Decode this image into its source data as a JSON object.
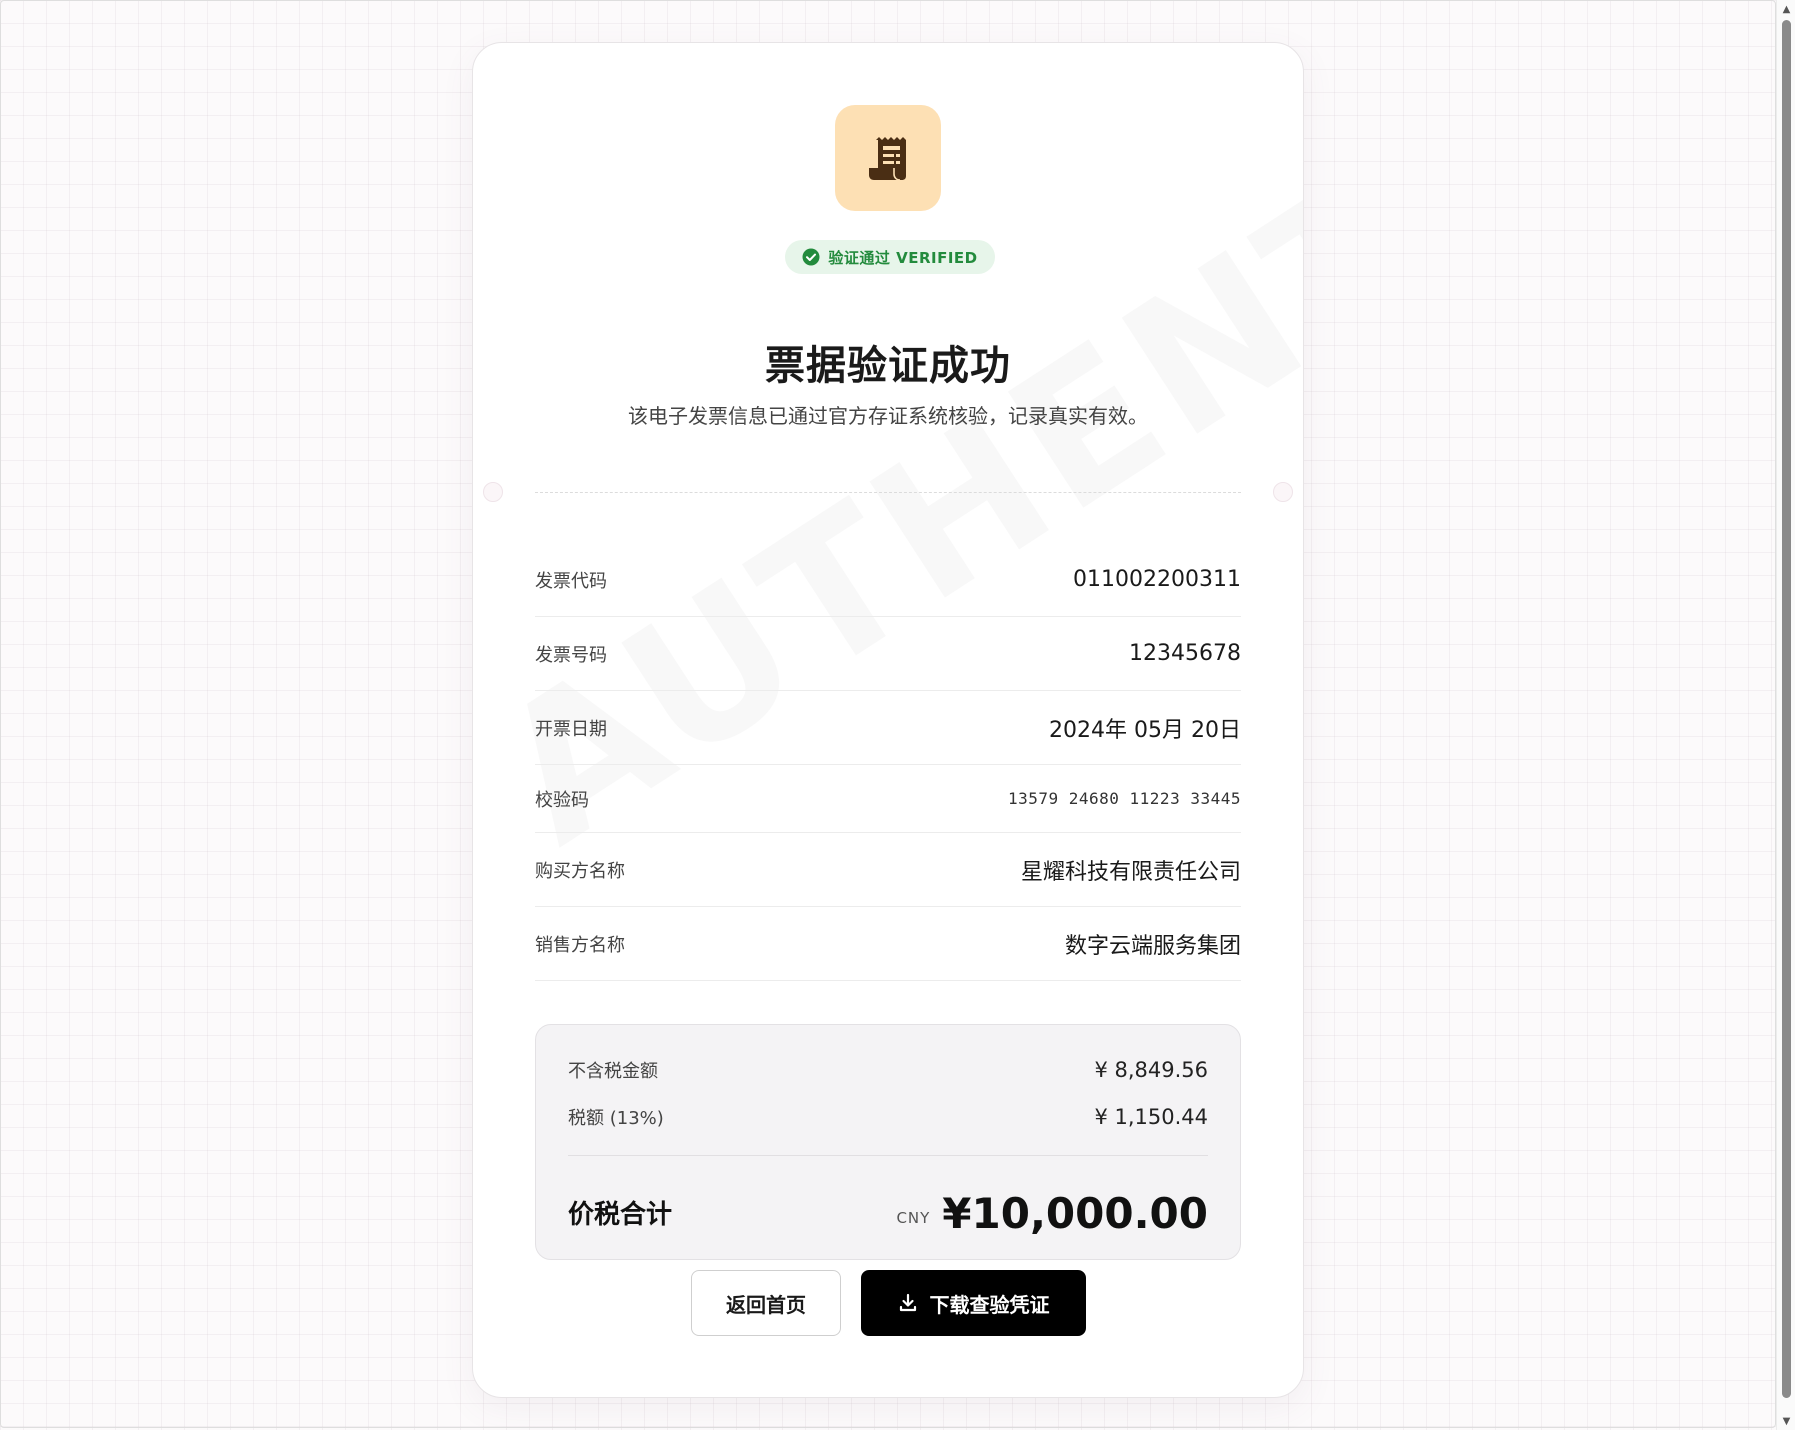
{
  "watermark": "AUTHENTIC",
  "badge": {
    "text": "验证通过 VERIFIED"
  },
  "title": "票据验证成功",
  "subtitle": "该电子发票信息已通过官方存证系统核验，记录真实有效。",
  "details": [
    {
      "label": "发票代码",
      "value": "011002200311"
    },
    {
      "label": "发票号码",
      "value": "12345678"
    },
    {
      "label": "开票日期",
      "value": "2024年 05月 20日"
    },
    {
      "label": "校验码",
      "value": "13579 24680 11223 33445"
    },
    {
      "label": "购买方名称",
      "value": "星耀科技有限责任公司"
    },
    {
      "label": "销售方名称",
      "value": "数字云端服务集团"
    }
  ],
  "summary": {
    "pretax_label": "不含税金额",
    "pretax_value": "¥ 8,849.56",
    "tax_label": "税额 (13%)",
    "tax_value": "¥ 1,150.44",
    "total_label": "价税合计",
    "currency": "CNY",
    "total_value": "¥10,000.00"
  },
  "buttons": {
    "home": "返回首页",
    "download": "下载查验凭证"
  },
  "colors": {
    "accent": "#000000",
    "verified_green": "#238b3d",
    "icon_bg": "#fde0b4"
  },
  "icons": {
    "receipt": "receipt-icon",
    "check": "check-circle-icon",
    "download": "download-icon"
  }
}
